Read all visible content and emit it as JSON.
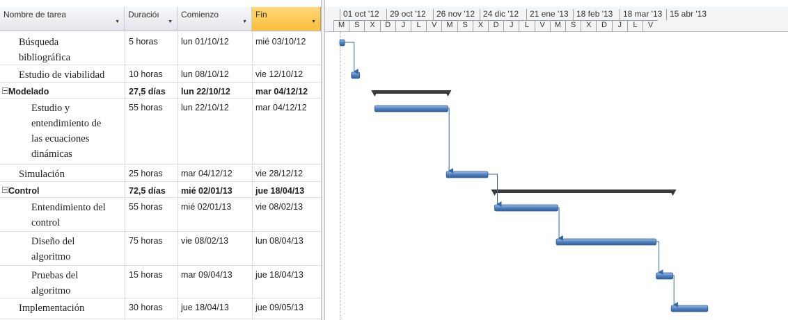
{
  "columns": {
    "name": "Nombre de tarea",
    "duration": "Duracióı",
    "start": "Comienzo",
    "finish": "Fin"
  },
  "timescale": {
    "major": [
      "01 oct '12",
      "29 oct '12",
      "26 nov '12",
      "24 dic '12",
      "21 ene '13",
      "18 feb '13",
      "18 mar '13",
      "15 abr '13"
    ],
    "minor": [
      "M",
      "S",
      "X",
      "D",
      "J",
      "L",
      "V",
      "M",
      "S",
      "X",
      "D",
      "J",
      "L",
      "V",
      "M",
      "S",
      "X",
      "D",
      "J",
      "L",
      "V"
    ]
  },
  "tasks": [
    {
      "name_lines": [
        "Búsqueda",
        "bibliográfica"
      ],
      "duration": "5 horas",
      "start": "lun 01/10/12",
      "finish": "mié 03/10/12",
      "summary": false
    },
    {
      "name_lines": [
        "Estudio de viabilidad"
      ],
      "duration": "10 horas",
      "start": "lun 08/10/12",
      "finish": "vie 12/10/12",
      "summary": false
    },
    {
      "name_lines": [
        "Modelado"
      ],
      "duration": "27,5 días",
      "start": "lun 22/10/12",
      "finish": "mar 04/12/12",
      "summary": true
    },
    {
      "name_lines": [
        "Estudio y",
        "entendimiento de",
        "las ecuaciones",
        "dinámicas"
      ],
      "duration": "55 horas",
      "start": "lun 22/10/12",
      "finish": "mar 04/12/12",
      "summary": false
    },
    {
      "name_lines": [
        "Simulación"
      ],
      "duration": "25 horas",
      "start": "mar 04/12/12",
      "finish": "vie 28/12/12",
      "summary": false
    },
    {
      "name_lines": [
        "Control"
      ],
      "duration": "72,5 días",
      "start": "mié 02/01/13",
      "finish": "jue 18/04/13",
      "summary": true
    },
    {
      "name_lines": [
        "Entendimiento del",
        "control"
      ],
      "duration": "55 horas",
      "start": "mié 02/01/13",
      "finish": "vie 08/02/13",
      "summary": false
    },
    {
      "name_lines": [
        "Diseño del",
        "algoritmo"
      ],
      "duration": "75 horas",
      "start": "vie 08/02/13",
      "finish": "lun 08/04/13",
      "summary": false
    },
    {
      "name_lines": [
        "Pruebas del",
        "algoritmo"
      ],
      "duration": "15 horas",
      "start": "mar 09/04/13",
      "finish": "jue 18/04/13",
      "summary": false
    },
    {
      "name_lines": [
        "Implementación"
      ],
      "duration": "30 horas",
      "start": "jue 18/04/13",
      "finish": "jue 09/05/13",
      "summary": false
    }
  ],
  "colors": {
    "task_bar": "#4f81bd",
    "summary_bar": "#3a3a3a",
    "link_line": "#3465a4",
    "fin_header": "#fbbf3a"
  }
}
